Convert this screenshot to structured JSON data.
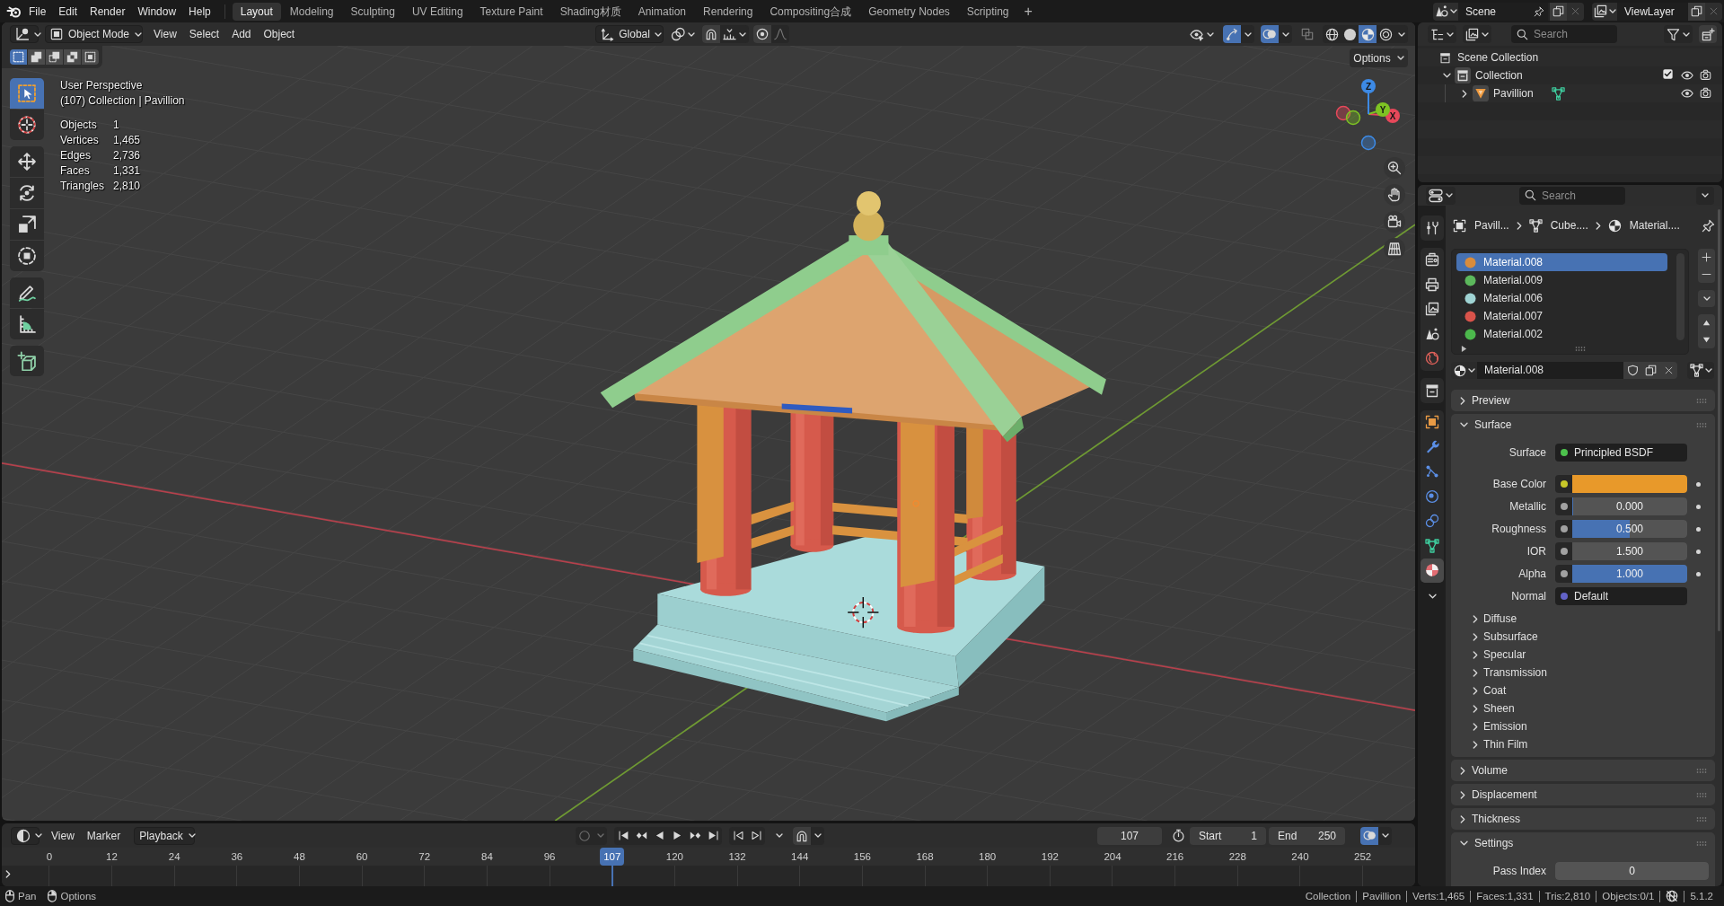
{
  "top_bar": {
    "menus": [
      "File",
      "Edit",
      "Render",
      "Window",
      "Help"
    ],
    "workspaces": [
      {
        "label": "Layout",
        "selected": true
      },
      {
        "label": "Modeling",
        "selected": false
      },
      {
        "label": "Sculpting",
        "selected": false
      },
      {
        "label": "UV Editing",
        "selected": false
      },
      {
        "label": "Texture Paint",
        "selected": false
      },
      {
        "label": "Shading材质",
        "selected": false
      },
      {
        "label": "Animation",
        "selected": false
      },
      {
        "label": "Rendering",
        "selected": false
      },
      {
        "label": "Compositing合成",
        "selected": false
      },
      {
        "label": "Geometry Nodes",
        "selected": false
      },
      {
        "label": "Scripting",
        "selected": false
      }
    ],
    "add_workspace": "+",
    "scene": "Scene",
    "view_layer": "ViewLayer"
  },
  "viewport": {
    "mode": "Object Mode",
    "menus": [
      "View",
      "Select",
      "Add",
      "Object"
    ],
    "orientation": "Global",
    "gizmos_on": true,
    "overlays_on": true,
    "xray_on": false,
    "shading": [
      {
        "kind": "wireframe",
        "selected": false
      },
      {
        "kind": "solid",
        "selected": false
      },
      {
        "kind": "material",
        "selected": true
      },
      {
        "kind": "rendered",
        "selected": false
      }
    ],
    "options": "Options",
    "select_modes": [
      {
        "kind": "set",
        "selected": true
      },
      {
        "kind": "extend",
        "selected": false
      },
      {
        "kind": "subtract",
        "selected": false
      },
      {
        "kind": "difference",
        "selected": false
      },
      {
        "kind": "intersect",
        "selected": false
      }
    ],
    "tool_groups": [
      [
        {
          "kind": "select_box",
          "selected": true
        },
        {
          "kind": "cursor",
          "selected": false
        }
      ],
      [
        {
          "kind": "move",
          "selected": false
        },
        {
          "kind": "rotate",
          "selected": false
        },
        {
          "kind": "scale",
          "selected": false
        },
        {
          "kind": "transform",
          "selected": false
        }
      ],
      [
        {
          "kind": "annotate",
          "selected": false
        },
        {
          "kind": "measure",
          "selected": false
        }
      ],
      [
        {
          "kind": "add_cube",
          "selected": false
        }
      ]
    ],
    "view_name": "User Perspective",
    "context": "(107) Collection | Pavillion",
    "stats": [
      {
        "label": "Objects",
        "value": "1"
      },
      {
        "label": "Vertices",
        "value": "1,465"
      },
      {
        "label": "Edges",
        "value": "2,736"
      },
      {
        "label": "Faces",
        "value": "1,331"
      },
      {
        "label": "Triangles",
        "value": "2,810"
      }
    ],
    "gizmo_axes": [
      {
        "label": "X",
        "color": "#e6485a"
      },
      {
        "label": "Y",
        "color": "#7ec323"
      },
      {
        "label": "Z",
        "color": "#3d8ae5"
      }
    ]
  },
  "timeline": {
    "menus": [
      "View",
      "Marker"
    ],
    "playback": "Playback",
    "keying_disabled": true,
    "current_frame": "107",
    "start_label": "Start",
    "start": "1",
    "end_label": "End",
    "end": "250",
    "ruler": [
      {
        "kind": "tick",
        "label": "0"
      },
      {
        "kind": "tick",
        "label": "12"
      },
      {
        "kind": "tick",
        "label": "24"
      },
      {
        "kind": "tick",
        "label": "36"
      },
      {
        "kind": "tick",
        "label": "48"
      },
      {
        "kind": "tick",
        "label": "60"
      },
      {
        "kind": "tick",
        "label": "72"
      },
      {
        "kind": "tick",
        "label": "84"
      },
      {
        "kind": "tick",
        "label": "96"
      },
      {
        "kind": "playhead",
        "label": "107"
      },
      {
        "kind": "tick",
        "label": "120"
      },
      {
        "kind": "tick",
        "label": "132"
      },
      {
        "kind": "tick",
        "label": "144"
      },
      {
        "kind": "tick",
        "label": "156"
      },
      {
        "kind": "tick",
        "label": "168"
      },
      {
        "kind": "tick",
        "label": "180"
      },
      {
        "kind": "tick",
        "label": "192"
      },
      {
        "kind": "tick",
        "label": "204"
      },
      {
        "kind": "tick",
        "label": "216"
      },
      {
        "kind": "tick",
        "label": "228"
      },
      {
        "kind": "tick",
        "label": "240"
      },
      {
        "kind": "tick",
        "label": "252"
      }
    ]
  },
  "outliner": {
    "search": {
      "placeholder": "Search"
    },
    "tree": [
      {
        "label": "Scene Collection",
        "kind": "scene_collection",
        "children": [
          {
            "label": "Collection",
            "kind": "collection",
            "expanded": true,
            "checked": true,
            "visible": true,
            "renderable": true,
            "children": [
              {
                "label": "Pavillion",
                "kind": "mesh_object",
                "expanded": false,
                "visible": true,
                "renderable": true
              }
            ]
          }
        ]
      }
    ]
  },
  "properties": {
    "search": {
      "placeholder": "Search"
    },
    "tab_groups": [
      [
        {
          "kind": "tool",
          "selected": false
        }
      ],
      [
        {
          "kind": "render",
          "selected": false
        },
        {
          "kind": "output",
          "selected": false
        },
        {
          "kind": "view_layer",
          "selected": false
        },
        {
          "kind": "scene",
          "selected": false
        },
        {
          "kind": "world",
          "selected": false
        }
      ],
      [
        {
          "kind": "collection",
          "selected": false
        }
      ],
      [
        {
          "kind": "object",
          "selected": false
        },
        {
          "kind": "modifiers",
          "selected": false
        },
        {
          "kind": "particles",
          "selected": false
        },
        {
          "kind": "physics",
          "selected": false
        },
        {
          "kind": "constraints",
          "selected": false
        },
        {
          "kind": "data",
          "selected": false
        },
        {
          "kind": "material",
          "selected": true
        }
      ]
    ],
    "breadcrumb": [
      {
        "kind": "object",
        "label": "Pavill..."
      },
      {
        "kind": "mesh",
        "label": "Cube...."
      },
      {
        "kind": "material",
        "label": "Material...."
      }
    ],
    "material_slots": [
      {
        "name": "Material.008",
        "color": "#d98c3c",
        "selected": true
      },
      {
        "name": "Material.009",
        "color": "#5cb85c",
        "selected": false
      },
      {
        "name": "Material.006",
        "color": "#9fd3d3",
        "selected": false
      },
      {
        "name": "Material.007",
        "color": "#d9534a",
        "selected": false
      },
      {
        "name": "Material.002",
        "color": "#4cb84c",
        "selected": false
      }
    ],
    "material_name": "Material.008",
    "panels": [
      {
        "title": "Preview",
        "expanded": false
      },
      {
        "title": "Surface",
        "expanded": true,
        "rows": [
          {
            "label": "Surface",
            "kind": "link",
            "color": "#4dc24d",
            "value": "Principled BSDF",
            "keyframe": false
          },
          {
            "label": "Base Color",
            "kind": "color",
            "color": "#c7c729",
            "swatch": {
              "color": "#e8992a"
            },
            "keyframe": true
          },
          {
            "label": "Metallic",
            "kind": "slider",
            "color": "#a1a1a1",
            "value": "0.000",
            "level": 0,
            "keyframe": true
          },
          {
            "label": "Roughness",
            "kind": "slider",
            "color": "#a1a1a1",
            "value": "0.500",
            "level": 0.5,
            "keyframe": true
          },
          {
            "label": "IOR",
            "kind": "number",
            "color": "#a1a1a1",
            "value": "1.500",
            "keyframe": true
          },
          {
            "label": "Alpha",
            "kind": "slider",
            "color": "#a1a1a1",
            "value": "1.000",
            "level": 1,
            "keyframe": true
          },
          {
            "label": "Normal",
            "kind": "link",
            "color": "#6363c7",
            "value": "Default",
            "keyframe": false
          }
        ],
        "subpanels": [
          {
            "label": "Diffuse",
            "expanded": false
          },
          {
            "label": "Subsurface",
            "expanded": false
          },
          {
            "label": "Specular",
            "expanded": false
          },
          {
            "label": "Transmission",
            "expanded": false
          },
          {
            "label": "Coat",
            "expanded": false
          },
          {
            "label": "Sheen",
            "expanded": false
          },
          {
            "label": "Emission",
            "expanded": false
          },
          {
            "label": "Thin Film",
            "expanded": false
          }
        ]
      },
      {
        "title": "Volume",
        "expanded": false
      },
      {
        "title": "Displacement",
        "expanded": false
      },
      {
        "title": "Thickness",
        "expanded": false
      },
      {
        "title": "Settings",
        "expanded": true,
        "rows": [
          {
            "label": "Pass Index",
            "kind": "number",
            "value": "0",
            "keyframe": false
          }
        ]
      }
    ]
  },
  "status_bar": {
    "hints": [
      {
        "kind": "mouse_middle",
        "label": "Pan"
      },
      {
        "kind": "mouse_right",
        "label": "Options"
      }
    ],
    "info": [
      "Collection",
      "Pavillion",
      "Verts:1,465",
      "Faces:1,331",
      "Tris:2,810",
      "Objects:0/1"
    ],
    "version": "5.1.2"
  }
}
